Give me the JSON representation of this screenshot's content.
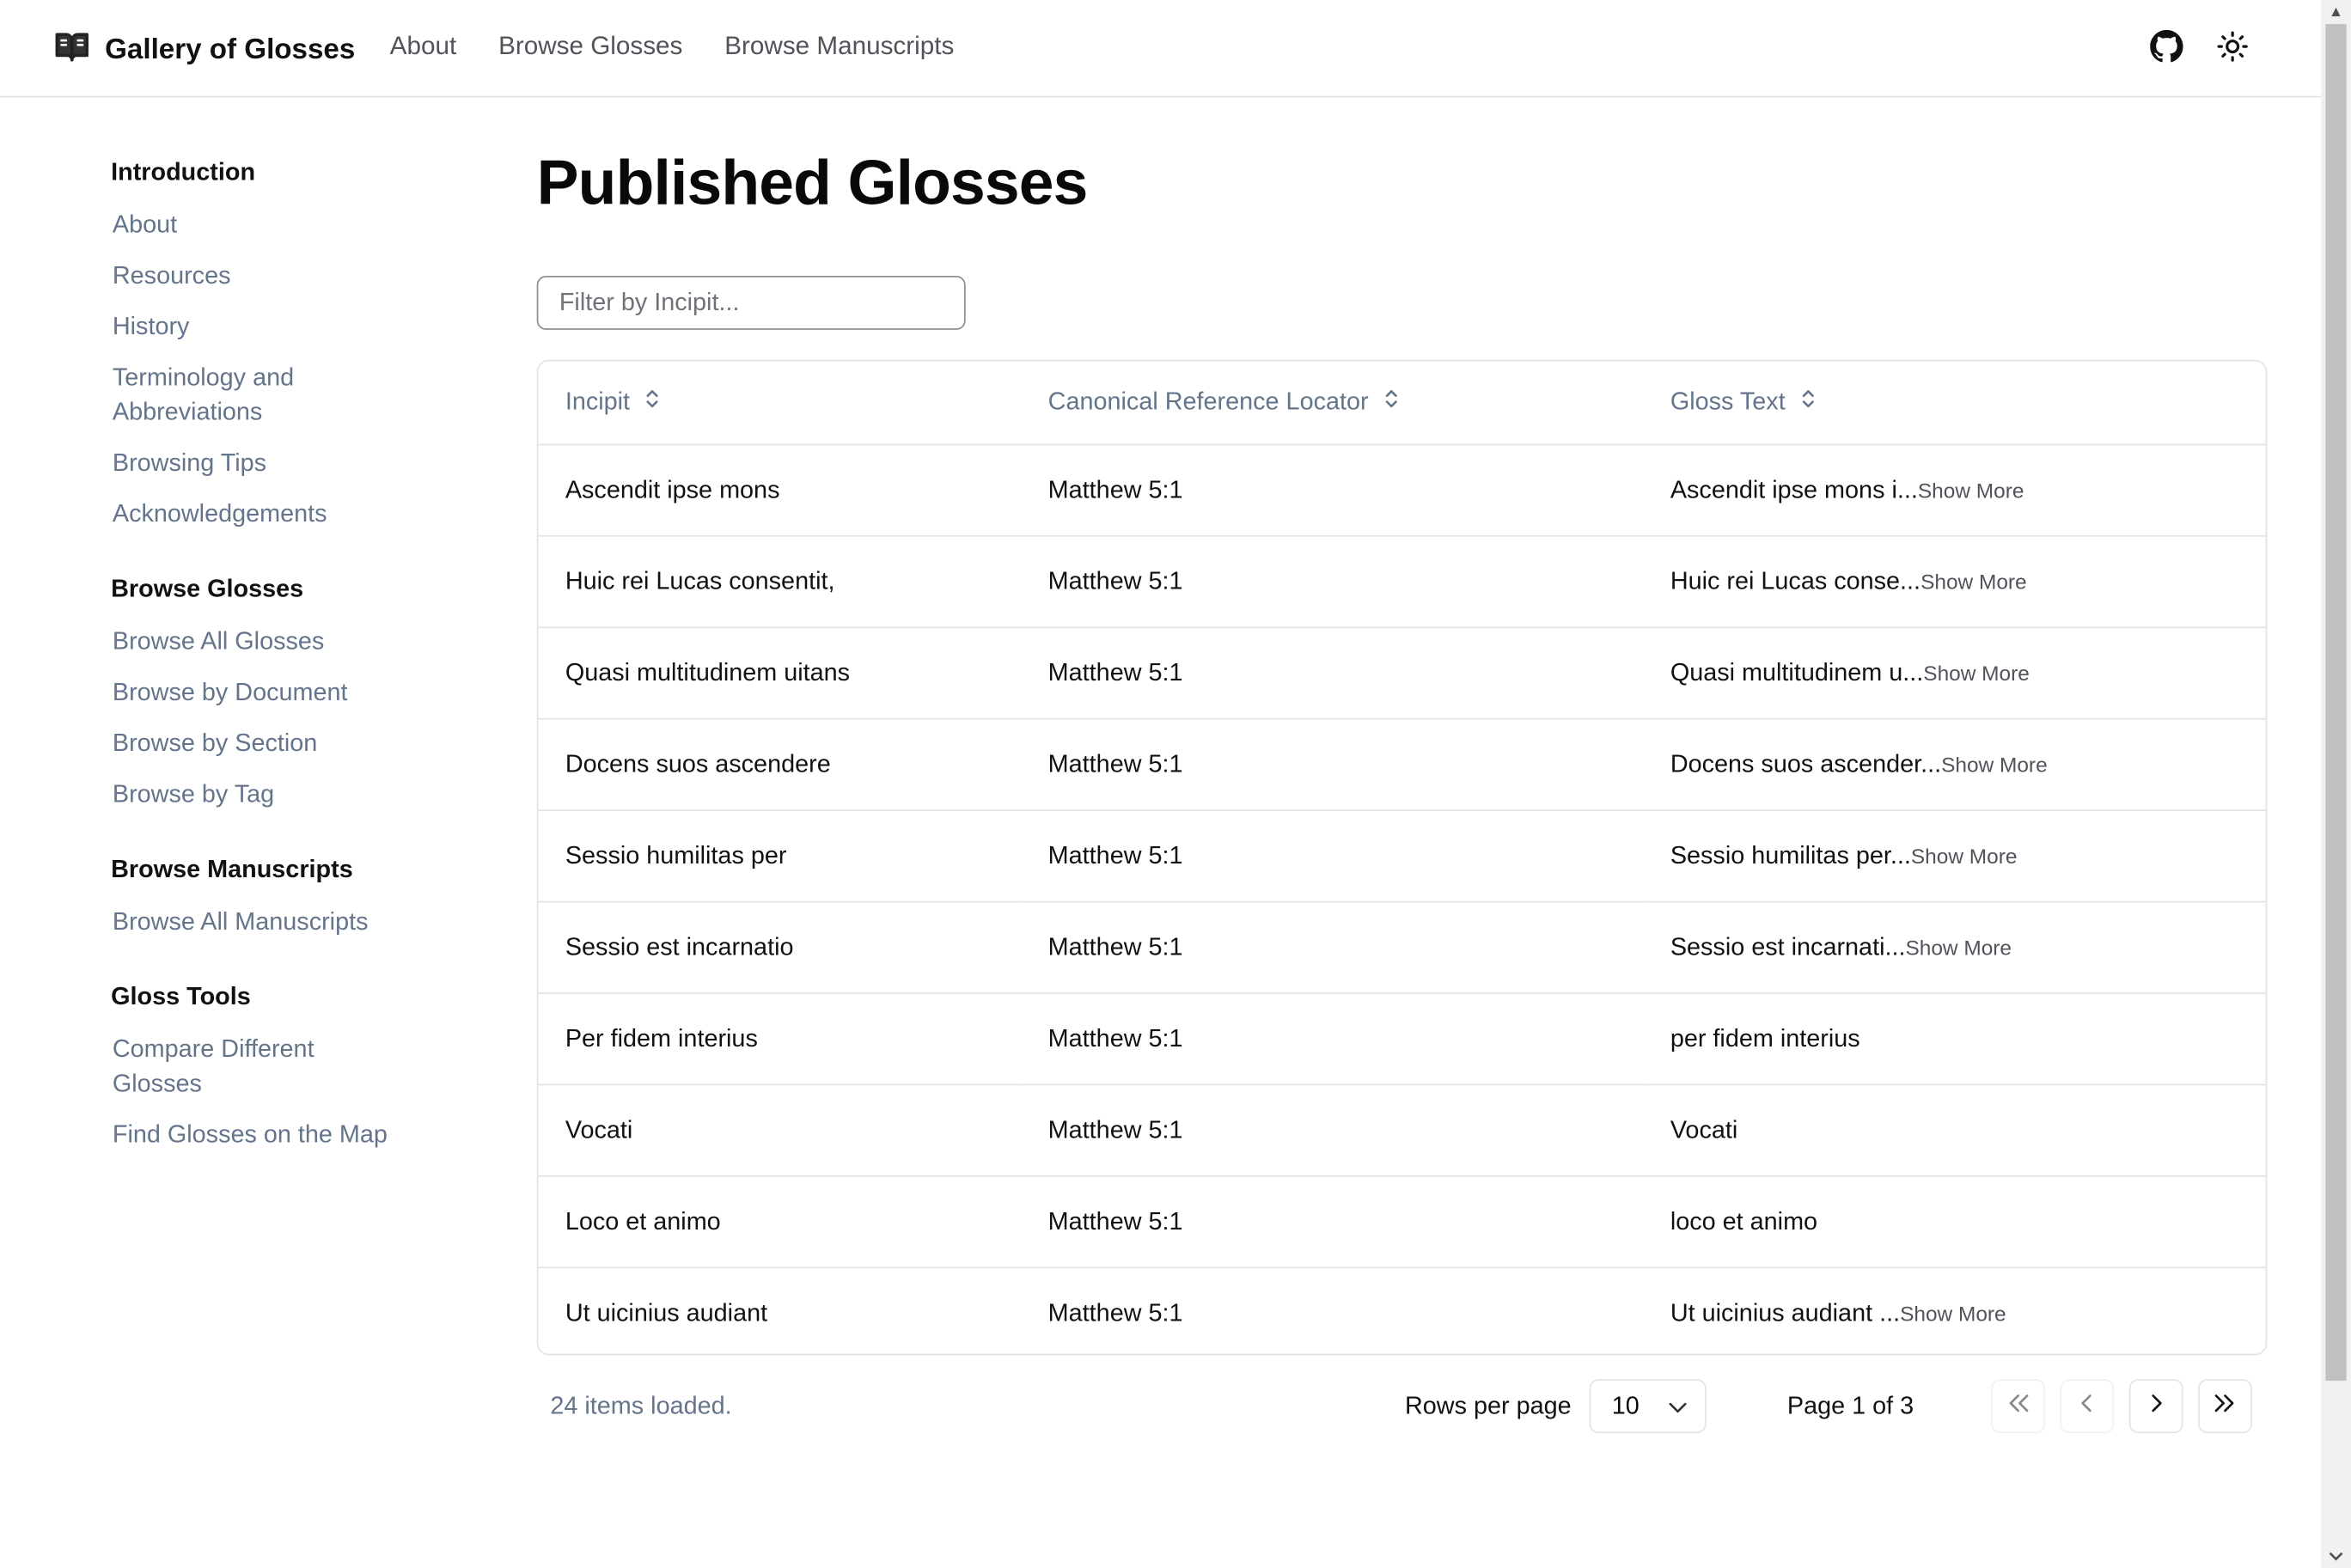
{
  "header": {
    "brand": "Gallery of Glosses",
    "nav": [
      "About",
      "Browse Glosses",
      "Browse Manuscripts"
    ],
    "icons": [
      "book-icon",
      "github-icon",
      "sun-icon"
    ]
  },
  "sidebar": {
    "sections": [
      {
        "heading": "Introduction",
        "items": [
          "About",
          "Resources",
          "History",
          "Terminology and Abbreviations",
          "Browsing Tips",
          "Acknowledgements"
        ]
      },
      {
        "heading": "Browse Glosses",
        "items": [
          "Browse All Glosses",
          "Browse by Document",
          "Browse by Section",
          "Browse by Tag"
        ]
      },
      {
        "heading": "Browse Manuscripts",
        "items": [
          "Browse All Manuscripts"
        ]
      },
      {
        "heading": "Gloss Tools",
        "items": [
          "Compare Different Glosses",
          "Find Glosses on the Map"
        ]
      }
    ]
  },
  "main": {
    "title": "Published Glosses",
    "filter_placeholder": "Filter by Incipit...",
    "filter_value": "",
    "columns": [
      "Incipit",
      "Canonical Reference Locator",
      "Gloss Text"
    ],
    "rows": [
      {
        "incipit": "Ascendit ipse mons",
        "locator": "Matthew 5:1",
        "gloss": "Ascendit ipse mons i...",
        "more": "Show More"
      },
      {
        "incipit": "Huic rei Lucas consentit,",
        "locator": "Matthew 5:1",
        "gloss": "Huic rei Lucas conse...",
        "more": "Show More"
      },
      {
        "incipit": "Quasi multitudinem uitans",
        "locator": "Matthew 5:1",
        "gloss": "Quasi multitudinem u...",
        "more": "Show More"
      },
      {
        "incipit": "Docens suos ascendere",
        "locator": "Matthew 5:1",
        "gloss": "Docens suos ascender...",
        "more": "Show More"
      },
      {
        "incipit": "Sessio humilitas per",
        "locator": "Matthew 5:1",
        "gloss": "Sessio humilitas per...",
        "more": "Show More"
      },
      {
        "incipit": "Sessio est incarnatio",
        "locator": "Matthew 5:1",
        "gloss": "Sessio est incarnati...",
        "more": "Show More"
      },
      {
        "incipit": "Per fidem interius",
        "locator": "Matthew 5:1",
        "gloss": "per fidem interius",
        "more": ""
      },
      {
        "incipit": "Vocati",
        "locator": "Matthew 5:1",
        "gloss": "Vocati",
        "more": ""
      },
      {
        "incipit": "Loco et animo",
        "locator": "Matthew 5:1",
        "gloss": "loco et animo",
        "more": ""
      },
      {
        "incipit": "Ut uicinius audiant",
        "locator": "Matthew 5:1",
        "gloss": "Ut uicinius audiant ...",
        "more": "Show More"
      }
    ]
  },
  "footer": {
    "loaded": "24 items loaded.",
    "rows_per_page_label": "Rows per page",
    "rows_per_page_value": "10",
    "page_status": "Page 1 of 3",
    "pagination_icons": [
      "first-page-icon",
      "previous-page-icon",
      "next-page-icon",
      "last-page-icon"
    ]
  }
}
